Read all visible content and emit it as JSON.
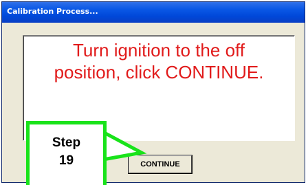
{
  "window": {
    "title": "Calibration Process..."
  },
  "message": {
    "line1": "Turn ignition to the off",
    "line2": "position, click CONTINUE."
  },
  "buttons": {
    "continue_label": "CONTINUE"
  },
  "callout": {
    "line1": "Step",
    "line2": "19"
  },
  "colors": {
    "message_text": "#e11b1b",
    "callout_border": "#19e31a",
    "titlebar": "#0a58e6",
    "dialog_bg": "#ece9d8"
  }
}
